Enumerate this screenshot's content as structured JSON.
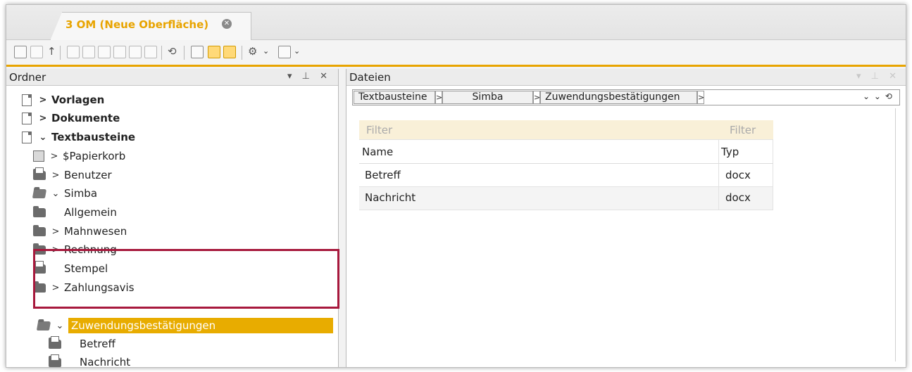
{
  "tab": {
    "label": "3 OM (Neue Oberfläche)",
    "close": "✕"
  },
  "toolbar": {
    "buttons": [
      "back-icon",
      "forward-icon",
      "up-icon",
      "print-icon",
      "preview-icon",
      "new-folder-icon",
      "new-document-icon",
      "export-icon",
      "delete-icon",
      "refresh-icon",
      "properties-icon",
      "search-icon",
      "view-icon",
      "settings-icon",
      "display-icon"
    ]
  },
  "left_pane": {
    "title": "Ordner",
    "controls": "▾ ⊥ ✕",
    "tree": [
      {
        "label": "Vorlagen",
        "chevron": ">",
        "bold": true
      },
      {
        "label": "Dokumente",
        "chevron": ">",
        "bold": true
      },
      {
        "label": "Textbausteine",
        "chevron": "⌄",
        "bold": true
      },
      {
        "label": "$Papierkorb",
        "chevron": ">"
      },
      {
        "label": "Benutzer",
        "chevron": ">"
      },
      {
        "label": "Simba",
        "chevron": "⌄"
      },
      {
        "label": "Allgemein",
        "chevron": ""
      },
      {
        "label": "Mahnwesen",
        "chevron": ">"
      },
      {
        "label": "Rechnung",
        "chevron": ">"
      },
      {
        "label": "Stempel",
        "chevron": ""
      },
      {
        "label": "Zahlungsavis",
        "chevron": ">"
      },
      {
        "label": "Zuwendungsbestätigungen",
        "chevron": "⌄",
        "selected": true
      },
      {
        "label": "Betreff",
        "chevron": ""
      },
      {
        "label": "Nachricht",
        "chevron": ""
      }
    ]
  },
  "right_pane": {
    "title": "Dateien",
    "controls": "▾ ⊥ ✕",
    "breadcrumb": [
      "Textbausteine",
      "Simba",
      "Zuwendungsbestätigungen"
    ],
    "breadcrumb_sep": ">",
    "actions": "⌄  ⌄  ⟲",
    "filter_placeholder": "Filter",
    "columns": [
      "Name",
      "Typ"
    ],
    "rows": [
      {
        "name": "Betreff",
        "typ": "docx"
      },
      {
        "name": "Nachricht",
        "typ": "docx"
      }
    ]
  },
  "colors": {
    "accent": "#e8a400",
    "highlight": "#a7183c"
  }
}
